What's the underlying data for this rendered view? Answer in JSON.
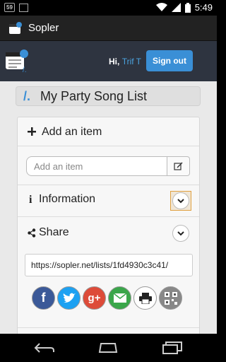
{
  "status_bar": {
    "badge": "59",
    "time": "5:49"
  },
  "app_bar": {
    "title": "Sopler"
  },
  "header": {
    "greeting": "Hi,",
    "user_name": "Trif T",
    "signout_label": "Sign out"
  },
  "list": {
    "slash": "/.",
    "title": "My Party Song List"
  },
  "add_item": {
    "heading": "Add an item",
    "placeholder": "Add an item",
    "value": ""
  },
  "information": {
    "heading": "Information"
  },
  "share": {
    "heading": "Share",
    "url": "https://sopler.net/lists/1fd4930c3c41/",
    "icons": [
      "facebook-icon",
      "twitter-icon",
      "google-plus-icon",
      "email-icon",
      "print-icon",
      "qr-code-icon"
    ]
  },
  "colors": {
    "accent": "#3a8fd6",
    "facebook": "#3b5998",
    "twitter": "#1da1f2",
    "google_plus": "#dd4b39",
    "email": "#3aa64a",
    "print": "#ffffff",
    "qr": "#888888"
  }
}
